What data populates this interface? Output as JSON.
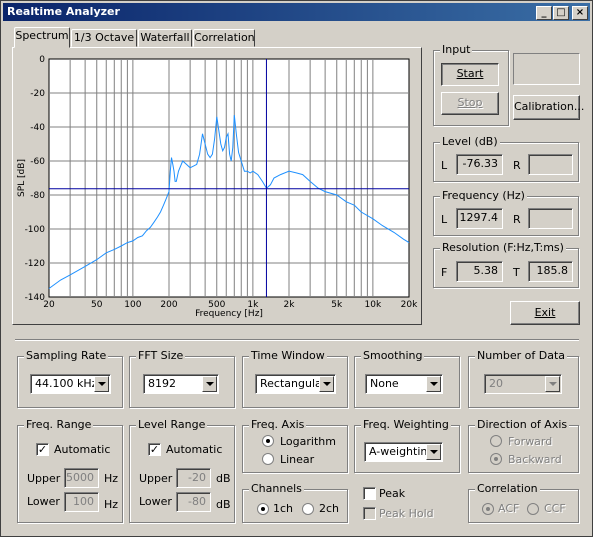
{
  "window": {
    "title": "Realtime Analyzer",
    "min": "_",
    "max": "□",
    "close": "×"
  },
  "tabs": [
    "Spectrum",
    "1/3 Octave",
    "Waterfall",
    "Correlation"
  ],
  "chart_data": {
    "type": "line",
    "title": "",
    "xlabel": "Frequency [Hz]",
    "ylabel": "SPL [dB]",
    "xscale": "log",
    "xlim": [
      20,
      20000
    ],
    "ylim": [
      -140,
      0
    ],
    "xticks": [
      20,
      50,
      100,
      200,
      500,
      1000,
      2000,
      5000,
      10000,
      20000
    ],
    "xtick_labels": [
      "20",
      "50",
      "100",
      "200",
      "500",
      "1k",
      "2k",
      "5k",
      "10k",
      "20k"
    ],
    "yticks": [
      0,
      -20,
      -40,
      -60,
      -80,
      -100,
      -120,
      -140
    ],
    "cursor": {
      "x": 1297.4,
      "y": -76.33
    },
    "series_color": "#1e90ff",
    "series": [
      {
        "x": [
          20,
          25,
          30,
          40,
          50,
          60,
          70,
          80,
          90,
          100,
          110,
          120,
          130,
          140,
          150,
          160,
          170,
          180,
          190,
          200,
          205,
          210,
          215,
          220,
          225,
          230,
          240,
          260,
          280,
          300,
          320,
          340,
          360,
          380,
          400,
          420,
          440,
          460,
          480,
          500,
          520,
          540,
          560,
          580,
          600,
          620,
          640,
          660,
          680,
          700,
          730,
          760,
          800,
          850,
          900,
          950,
          1000,
          1100,
          1200,
          1300,
          1400,
          1500,
          1700,
          2000,
          2300,
          2600,
          3000,
          3500,
          4000,
          5000,
          6000,
          7000,
          8000,
          10000,
          12000,
          15000,
          18000,
          20000
        ],
        "y": [
          -135,
          -130,
          -127,
          -122,
          -118,
          -114,
          -112,
          -110,
          -108,
          -107,
          -105,
          -104,
          -101,
          -99,
          -96,
          -93,
          -90,
          -86,
          -82,
          -78,
          -66,
          -58,
          -62,
          -66,
          -72,
          -72,
          -66,
          -60,
          -62,
          -64,
          -63,
          -62,
          -56,
          -44,
          -50,
          -56,
          -58,
          -56,
          -47,
          -34,
          -42,
          -50,
          -54,
          -52,
          -46,
          -44,
          -56,
          -60,
          -52,
          -33,
          -45,
          -55,
          -60,
          -66,
          -66,
          -67,
          -66,
          -68,
          -72,
          -76,
          -74,
          -70,
          -68,
          -66,
          -67,
          -68,
          -72,
          -76,
          -78,
          -80,
          -84,
          -86,
          -90,
          -94,
          -98,
          -102,
          -106,
          -108
        ]
      }
    ]
  },
  "input": {
    "label": "Input",
    "start": "Start",
    "stop": "Stop",
    "calibration": "Calibration..."
  },
  "level": {
    "label": "Level (dB)",
    "l_label": "L",
    "l_value": "-76.33",
    "r_label": "R",
    "r_value": ""
  },
  "frequency": {
    "label": "Frequency (Hz)",
    "l_label": "L",
    "l_value": "1297.4",
    "r_label": "R",
    "r_value": ""
  },
  "resolution": {
    "label": "Resolution (F:Hz,T:ms)",
    "f_label": "F",
    "f_value": "5.38",
    "t_label": "T",
    "t_value": "185.8"
  },
  "exit": "Exit",
  "sampling_rate": {
    "label": "Sampling Rate",
    "value": "44.100 kHz"
  },
  "fft_size": {
    "label": "FFT Size",
    "value": "8192"
  },
  "time_window": {
    "label": "Time Window",
    "value": "Rectangular"
  },
  "smoothing": {
    "label": "Smoothing",
    "value": "None"
  },
  "number_of_data": {
    "label": "Number of Data",
    "value": "20"
  },
  "freq_range": {
    "label": "Freq. Range",
    "automatic": "Automatic",
    "upper_label": "Upper",
    "upper_value": "5000",
    "lower_label": "Lower",
    "lower_value": "100",
    "unit": "Hz"
  },
  "level_range": {
    "label": "Level Range",
    "automatic": "Automatic",
    "upper_label": "Upper",
    "upper_value": "-20",
    "lower_label": "Lower",
    "lower_value": "-80",
    "unit": "dB"
  },
  "freq_axis": {
    "label": "Freq. Axis",
    "logarithm": "Logarithm",
    "linear": "Linear"
  },
  "freq_weighting": {
    "label": "Freq. Weighting",
    "value": "A-weighting"
  },
  "direction_of_axis": {
    "label": "Direction of Axis",
    "forward": "Forward",
    "backward": "Backward"
  },
  "channels": {
    "label": "Channels",
    "ch1": "1ch",
    "ch2": "2ch"
  },
  "peak": {
    "label": "Peak",
    "hold": "Peak Hold"
  },
  "correlation": {
    "label": "Correlation",
    "acf": "ACF",
    "ccf": "CCF"
  }
}
